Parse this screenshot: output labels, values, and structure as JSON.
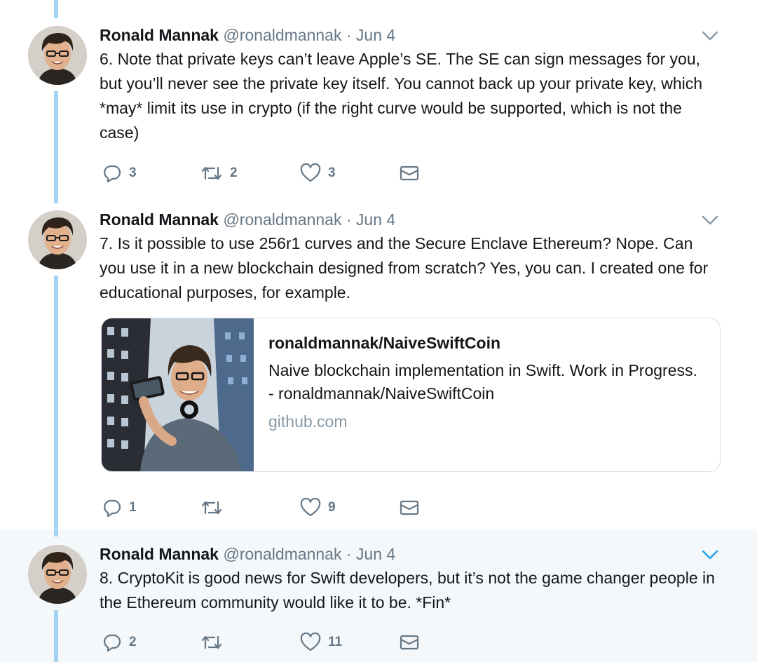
{
  "colors": {
    "thread_line": "#a3d4f4",
    "highlight_bg": "#f5f8fa",
    "secondary_text": "#657786",
    "chevron_active": "#1da1f2",
    "chevron_inactive": "#8899a6"
  },
  "icons": {
    "reply": "reply-icon",
    "retweet": "retweet-icon",
    "like": "heart-icon",
    "dm": "envelope-icon",
    "caret": "chevron-down-icon"
  },
  "tweets": [
    {
      "name": "Ronald Mannak",
      "handle": "@ronaldmannak",
      "sep": "·",
      "date": "Jun 4",
      "text": "6. Note that private keys can’t leave Apple’s SE. The SE can sign messages for you, but you’ll never see the private key itself. You cannot back up your private key, which *may* limit its use in crypto (if the right curve would be supported, which is not the case)",
      "replies": "3",
      "retweets": "2",
      "likes": "3"
    },
    {
      "name": "Ronald Mannak",
      "handle": "@ronaldmannak",
      "sep": "·",
      "date": "Jun 4",
      "text": "7. Is it possible to use 256r1 curves and the Secure Enclave Ethereum? Nope. Can you use it in a new blockchain designed from scratch? Yes, you can. I created one for educational purposes, for example.",
      "card": {
        "title": "ronaldmannak/NaiveSwiftCoin",
        "description": "Naive blockchain implementation in Swift. Work in Progress. - ronaldmannak/NaiveSwiftCoin",
        "url": "github.com"
      },
      "replies": "1",
      "retweets": "",
      "likes": "9"
    },
    {
      "name": "Ronald Mannak",
      "handle": "@ronaldmannak",
      "sep": "·",
      "date": "Jun 4",
      "text": "8. CryptoKit is good news for Swift developers, but it’s not the game changer people in the Ethereum community would like it to be. *Fin*",
      "replies": "2",
      "retweets": "",
      "likes": "11"
    }
  ]
}
